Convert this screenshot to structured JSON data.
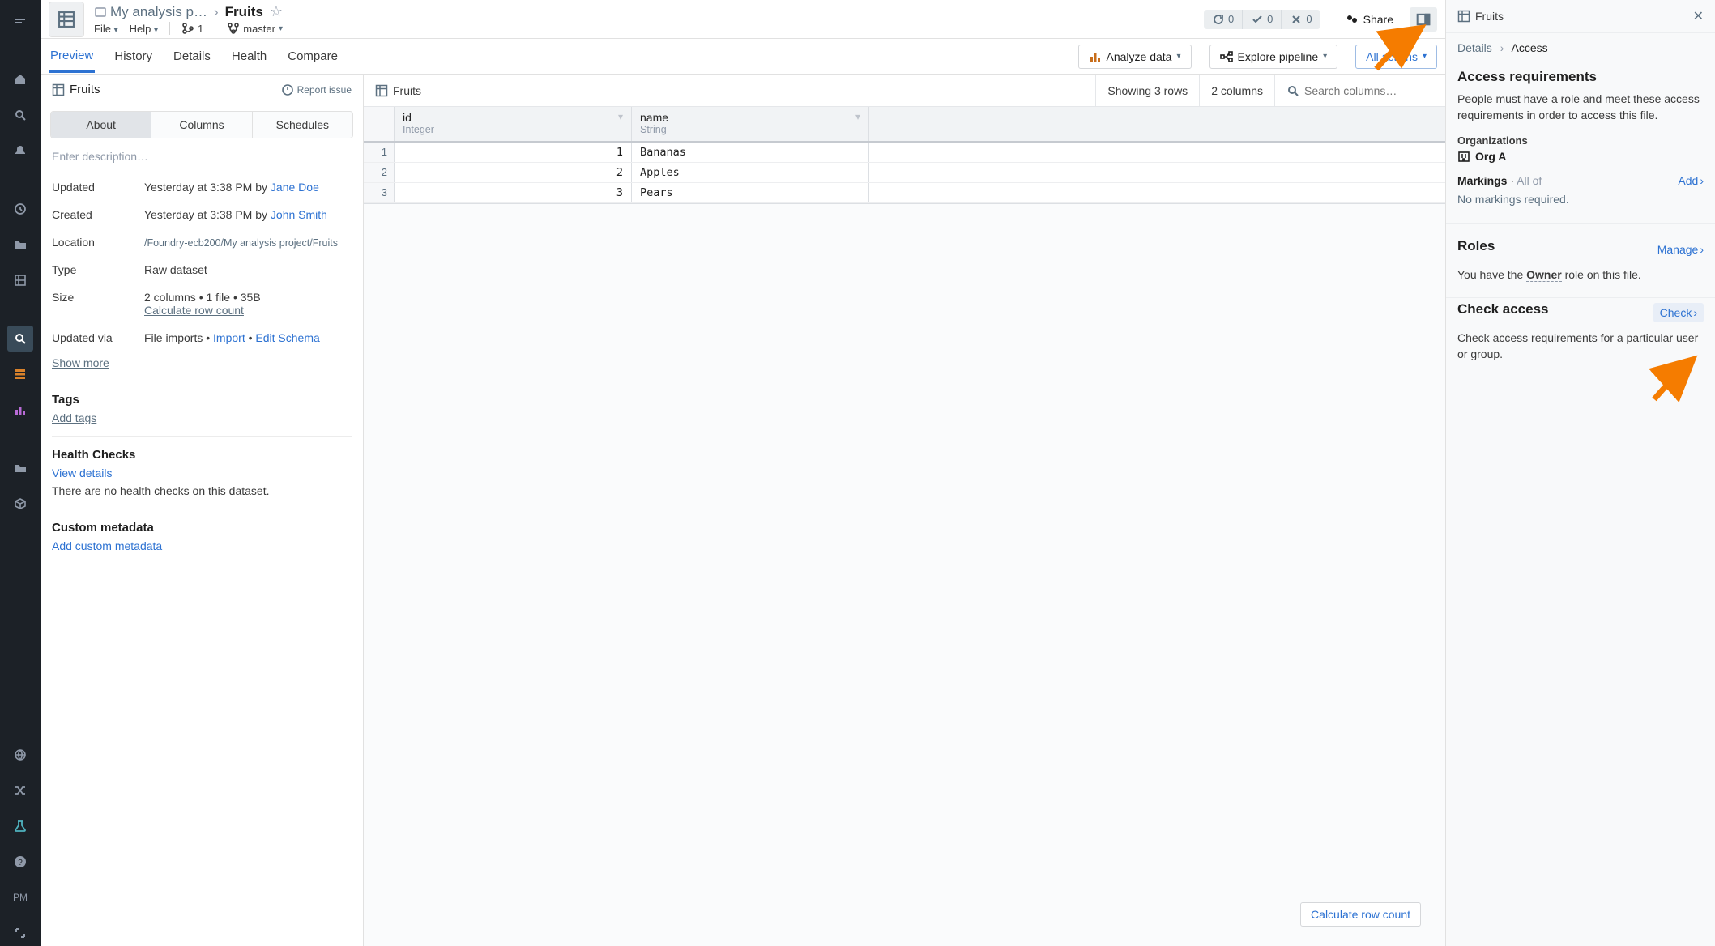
{
  "rail": {
    "pm": "PM"
  },
  "breadcrumb": {
    "project": "My analysis p…",
    "title": "Fruits"
  },
  "menus": {
    "file": "File",
    "help": "Help",
    "branch_count": "1",
    "branch": "master"
  },
  "status_pills": {
    "refresh": "0",
    "checks": "0",
    "errors": "0"
  },
  "share": "Share",
  "toolbar_btns": {
    "analyze": "Analyze data",
    "explore": "Explore pipeline",
    "actions": "All actions"
  },
  "tabs": [
    "Preview",
    "History",
    "Details",
    "Health",
    "Compare"
  ],
  "left_panel": {
    "title": "Fruits",
    "report_issue": "Report issue",
    "subtabs": [
      "About",
      "Columns",
      "Schedules"
    ],
    "description_placeholder": "Enter description…",
    "updated": {
      "k": "Updated",
      "prefix": "Yesterday at 3:38 PM by ",
      "user": "Jane Doe"
    },
    "created": {
      "k": "Created",
      "prefix": "Yesterday at 3:38 PM by ",
      "user": "John Smith"
    },
    "location": {
      "k": "Location",
      "v": "/Foundry-ecb200/My analysis project/Fruits"
    },
    "type": {
      "k": "Type",
      "v": "Raw dataset"
    },
    "size": {
      "k": "Size",
      "v": "2 columns • 1 file • 35B",
      "calc": "Calculate row count"
    },
    "updated_via": {
      "k": "Updated via",
      "prefix": "File imports • ",
      "import": "Import",
      "dot": " • ",
      "edit": "Edit Schema"
    },
    "show_more": "Show more",
    "tags": {
      "title": "Tags",
      "add": "Add tags"
    },
    "health": {
      "title": "Health Checks",
      "link": "View details",
      "body": "There are no health checks on this dataset."
    },
    "meta": {
      "title": "Custom metadata",
      "link": "Add custom metadata"
    }
  },
  "table": {
    "title": "Fruits",
    "showing": "Showing 3 rows",
    "columns_count": "2 columns",
    "search_placeholder": "Search columns…",
    "columns": [
      {
        "name": "id",
        "type": "Integer"
      },
      {
        "name": "name",
        "type": "String"
      }
    ],
    "rows": [
      {
        "n": "1",
        "id": "1",
        "name": "Bananas"
      },
      {
        "n": "2",
        "id": "2",
        "name": "Apples"
      },
      {
        "n": "3",
        "id": "3",
        "name": "Pears"
      }
    ],
    "calc_btn": "Calculate row count"
  },
  "side": {
    "title": "Fruits",
    "crumb_prev": "Details",
    "crumb_cur": "Access",
    "access_req": {
      "title": "Access requirements",
      "body": "People must have a role and meet these access requirements in order to access this file.",
      "orgs_label": "Organizations",
      "org": "Org A",
      "markings_label": "Markings",
      "all_of": "All of",
      "add": "Add",
      "no_markings": "No markings required."
    },
    "roles": {
      "title": "Roles",
      "manage": "Manage",
      "body_prefix": "You have the ",
      "owner": "Owner",
      "body_suffix": " role on this file."
    },
    "check": {
      "title": "Check access",
      "btn": "Check",
      "body": "Check access requirements for a particular user or group."
    }
  }
}
